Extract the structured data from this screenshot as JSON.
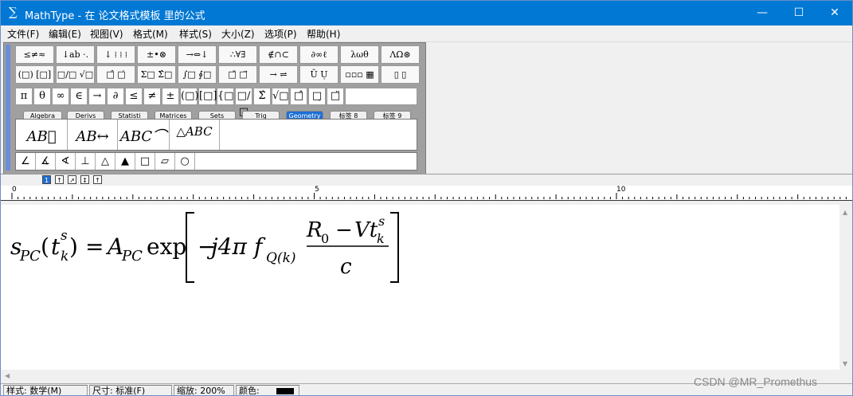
{
  "window": {
    "title": "MathType - 在 论文格式模板 里的公式",
    "app_icon": "sigma-icon",
    "min": "—",
    "max": "☐",
    "close": "✕"
  },
  "menu": [
    "文件(F)",
    "编辑(E)",
    "视图(V)",
    "格式(M)",
    "样式(S)",
    "大小(Z)",
    "选项(P)",
    "帮助(H)"
  ],
  "palette": {
    "row1": [
      "≤≠≈",
      "↓ab ·.",
      "↓ ⁞ ⁞ ⁞",
      "±•⊗",
      "→⇔↓",
      "∴∀∃",
      "∉∩⊂",
      "∂∞ℓ",
      "λωθ",
      "ΛΩ⊛"
    ],
    "row2": [
      "(□) [□]",
      "□/□ √□",
      "□̂ □̇",
      "Σ□ Σ̂□",
      "∫□ ∮□",
      "□̄ □⃗",
      "→ ⇌",
      "Ū Ụ",
      "▫▫▫ ▦",
      "▯ ▯"
    ],
    "row3": [
      "π",
      "θ",
      "∞",
      "∈",
      "→",
      "∂",
      "≤",
      "≠",
      "±",
      "(□)",
      "[□]",
      "{□}",
      "□/□",
      "Σ̂",
      "√□",
      "□̂",
      "□̣",
      "□̈"
    ],
    "tabs": [
      "Algebra",
      "Derivs",
      "Statisti",
      "Matrices",
      "Sets",
      "Trig",
      "Geometry",
      "标签 8",
      "标签 9"
    ],
    "active_tab": "Geometry",
    "templates": [
      "AB⃗",
      "AB↔",
      "ABC⌒",
      "△ABC"
    ],
    "geometry": [
      "∠",
      "∡",
      "∢",
      "⊥",
      "△",
      "▲",
      "□",
      "▱",
      "○"
    ]
  },
  "small_buttons": [
    "1",
    "↑",
    "↗",
    "↕",
    "↑"
  ],
  "ruler": {
    "labels": [
      "0",
      "5",
      "10"
    ]
  },
  "equation": {
    "lhs_main": "s",
    "lhs_sub": "PC",
    "paren_main": "t",
    "paren_sup": "s",
    "paren_sub": "k",
    "equals": "=",
    "A": "A",
    "A_sub": "PC",
    "exp": "exp",
    "minus": "−",
    "j4pi": "j4π",
    "f": "f",
    "f_sub": "Q(k)",
    "num_R": "R",
    "num_R_sub": "0",
    "num_minus": "−",
    "num_V": "Vt",
    "num_sup": "s",
    "num_sub": "k",
    "den": "c"
  },
  "status": {
    "style": "样式: 数学(M)",
    "size": "尺寸: 标准(F)",
    "zoom": "缩放: 200%",
    "color_label": "颜色:",
    "color_value": "#000000"
  },
  "watermark": "CSDN @MR_Promethus"
}
